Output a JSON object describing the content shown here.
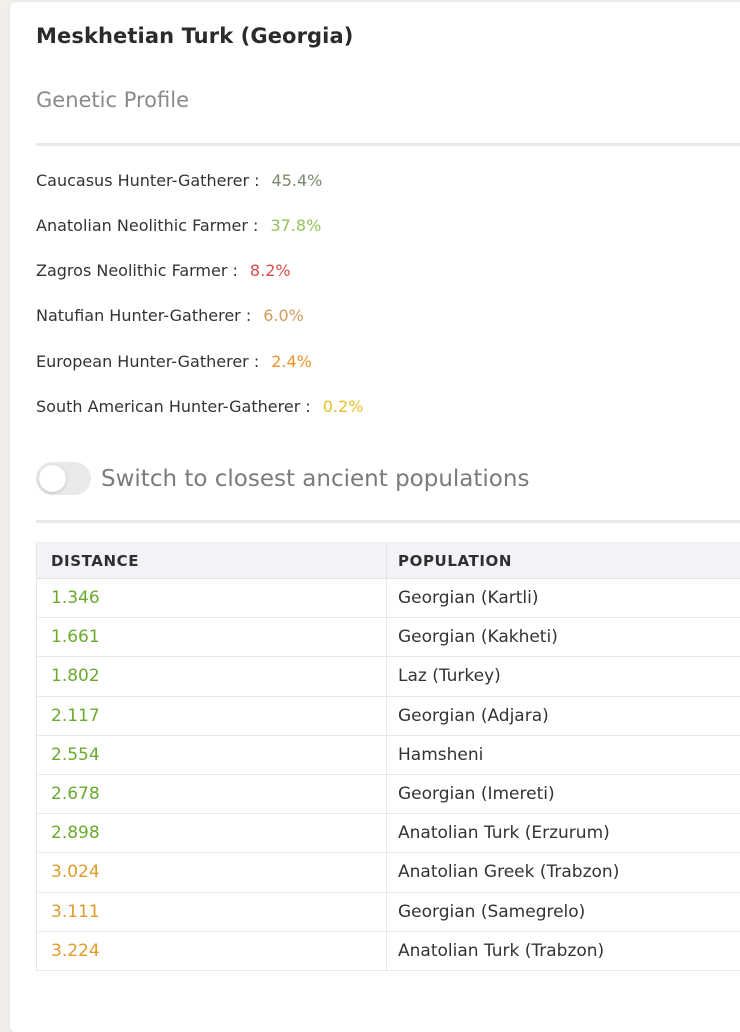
{
  "header": {
    "title": "Meskhetian Turk (Georgia)",
    "subtitle": "Genetic Profile"
  },
  "components": [
    {
      "label": "Caucasus Hunter-Gatherer :",
      "value": "45.4%",
      "color": "#7a8a6a"
    },
    {
      "label": "Anatolian Neolithic Farmer :",
      "value": "37.8%",
      "color": "#94c25a"
    },
    {
      "label": "Zagros Neolithic Farmer :",
      "value": "8.2%",
      "color": "#e04a4a"
    },
    {
      "label": "Natufian Hunter-Gatherer :",
      "value": "6.0%",
      "color": "#d49a5a"
    },
    {
      "label": "European Hunter-Gatherer :",
      "value": "2.4%",
      "color": "#e8952a"
    },
    {
      "label": "South American Hunter-Gatherer :",
      "value": "0.2%",
      "color": "#e6c02a"
    }
  ],
  "toggle": {
    "label": "Switch to closest ancient populations",
    "state": "off"
  },
  "table": {
    "headers": [
      "DISTANCE",
      "POPULATION"
    ],
    "rows": [
      {
        "distance": "1.346",
        "population": "Georgian (Kartli)",
        "color": "#6aab2e"
      },
      {
        "distance": "1.661",
        "population": "Georgian (Kakheti)",
        "color": "#6aab2e"
      },
      {
        "distance": "1.802",
        "population": "Laz (Turkey)",
        "color": "#6aab2e"
      },
      {
        "distance": "2.117",
        "population": "Georgian (Adjara)",
        "color": "#6aab2e"
      },
      {
        "distance": "2.554",
        "population": "Hamsheni",
        "color": "#6aab2e"
      },
      {
        "distance": "2.678",
        "population": "Georgian (Imereti)",
        "color": "#6aab2e"
      },
      {
        "distance": "2.898",
        "population": "Anatolian Turk (Erzurum)",
        "color": "#6aab2e"
      },
      {
        "distance": "3.024",
        "population": "Anatolian Greek (Trabzon)",
        "color": "#e09b2a"
      },
      {
        "distance": "3.111",
        "population": "Georgian (Samegrelo)",
        "color": "#e09b2a"
      },
      {
        "distance": "3.224",
        "population": "Anatolian Turk (Trabzon)",
        "color": "#e09b2a"
      }
    ]
  }
}
